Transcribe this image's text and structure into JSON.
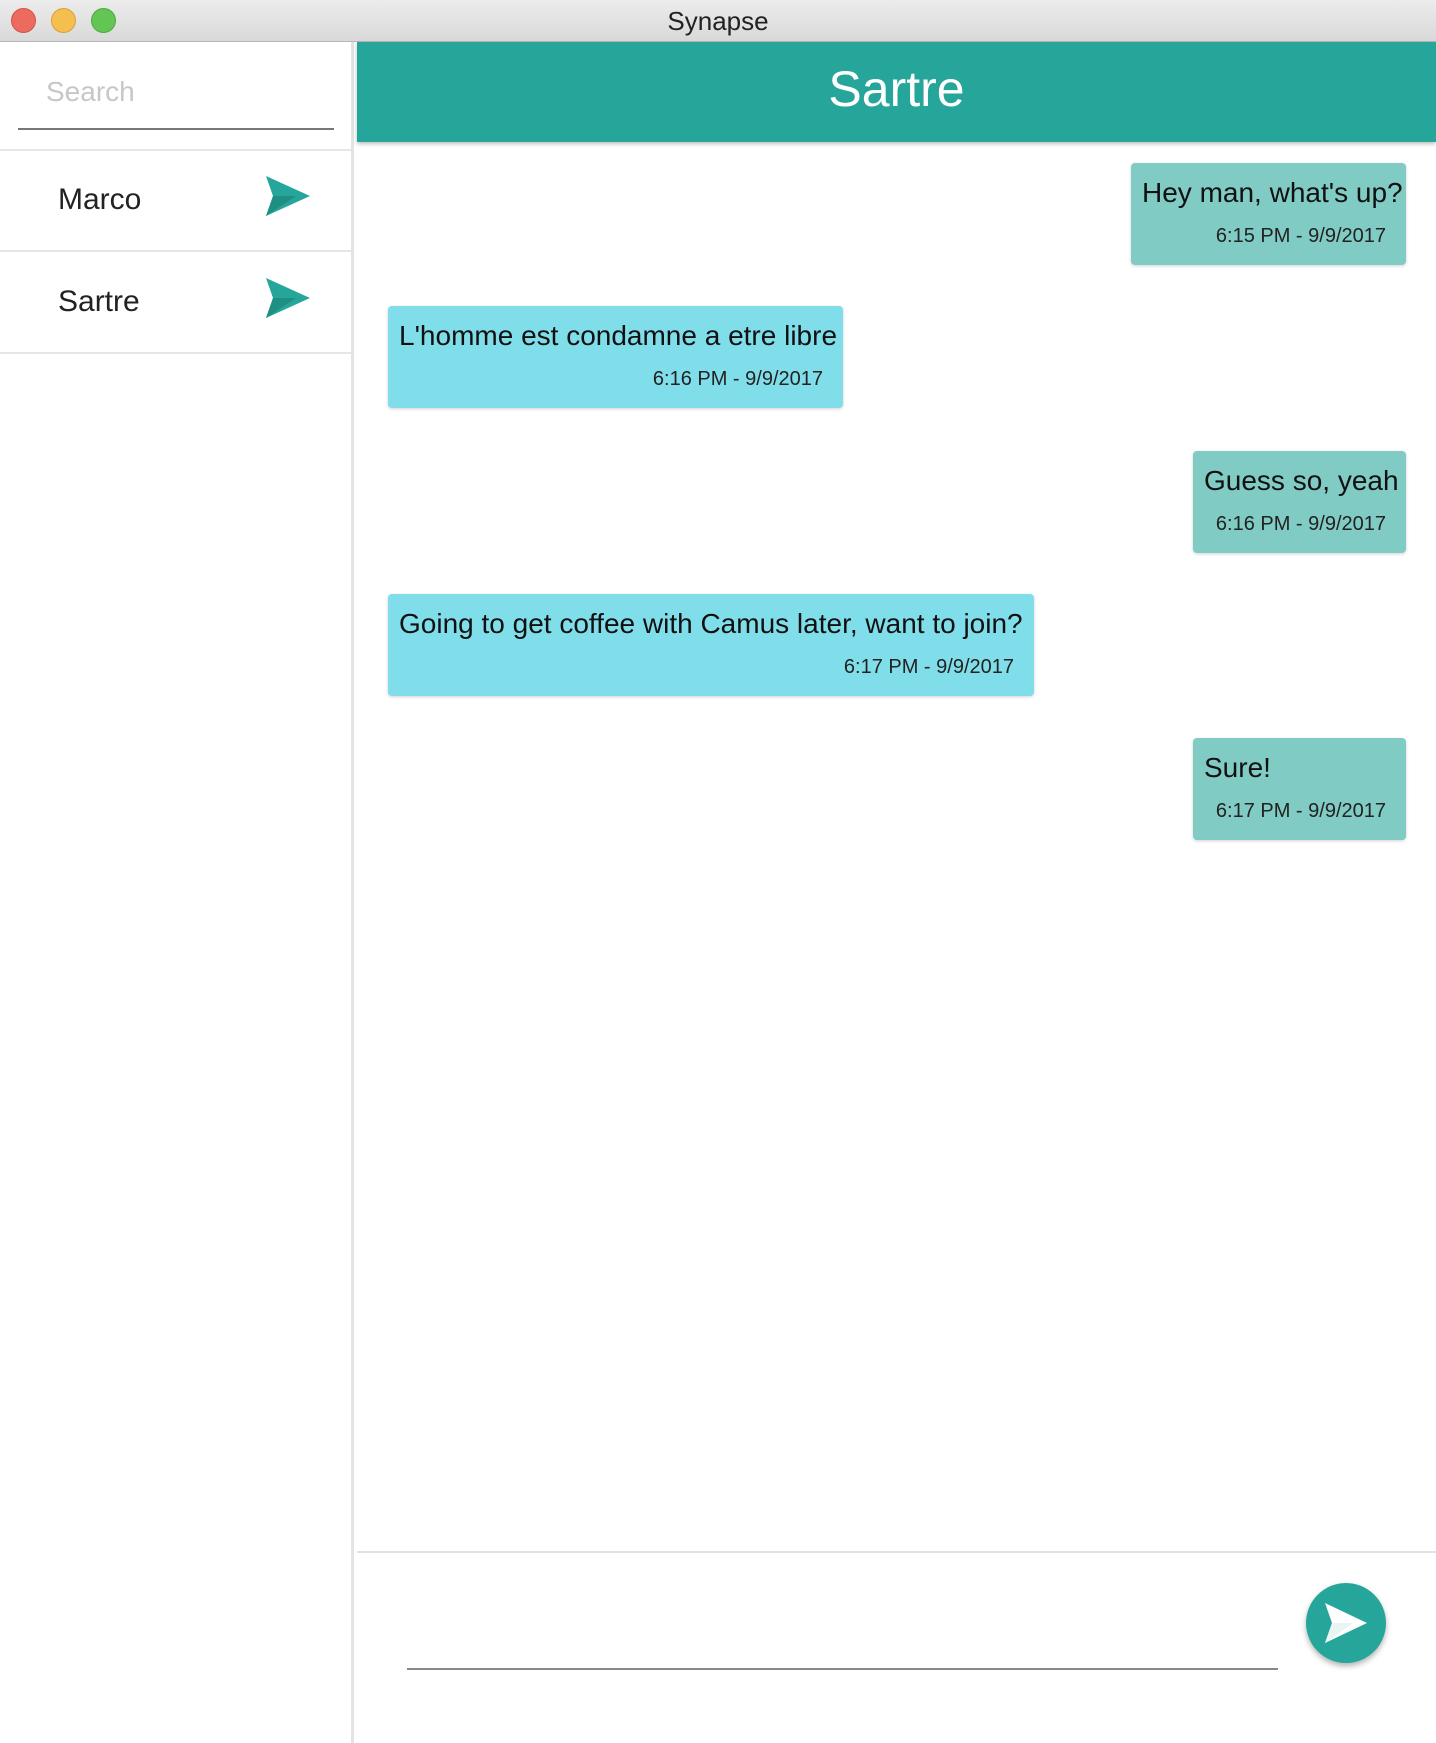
{
  "window": {
    "title": "Synapse"
  },
  "sidebar": {
    "search": {
      "placeholder": "Search",
      "value": ""
    },
    "contacts": [
      {
        "name": "Marco",
        "icon": "send-icon"
      },
      {
        "name": "Sartre",
        "icon": "send-icon"
      }
    ]
  },
  "chat": {
    "title": "Sartre",
    "messages": [
      {
        "direction": "outgoing",
        "text": "Hey man, what's up?",
        "time": "6:15 PM - 9/9/2017"
      },
      {
        "direction": "incoming",
        "text": "L'homme est condamne a etre libre",
        "time": "6:16 PM - 9/9/2017"
      },
      {
        "direction": "outgoing",
        "text": "Guess so, yeah",
        "time": "6:16 PM - 9/9/2017"
      },
      {
        "direction": "incoming",
        "text": "Going to get coffee with Camus later, want to join?",
        "time": "6:17 PM - 9/9/2017"
      },
      {
        "direction": "outgoing",
        "text": "Sure!",
        "time": "6:17 PM - 9/9/2017"
      }
    ]
  },
  "composer": {
    "value": "",
    "send_icon": "send-icon"
  },
  "colors": {
    "accent": "#26a69a",
    "outgoing_bubble": "#80cbc4",
    "incoming_bubble": "#80deea"
  }
}
